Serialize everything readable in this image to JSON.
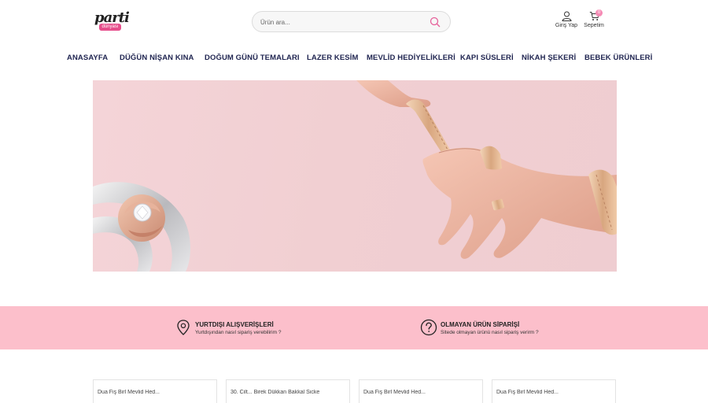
{
  "header": {
    "logo_text": "parti",
    "logo_sub": "dünyası",
    "search_placeholder": "Ürün ara...",
    "login_label": "Giriş Yap",
    "cart_label": "Sepetim",
    "cart_count": "0"
  },
  "nav": {
    "items": [
      {
        "label": "ANASAYFA"
      },
      {
        "label": "DÜĞÜN NİŞAN KINA"
      },
      {
        "label": "DOĞUM GÜNÜ TEMALARI"
      },
      {
        "label": "LAZER KESİM"
      },
      {
        "label": "MEVLİD HEDİYELİKLERİ"
      },
      {
        "label": "KAPI SÜSLERİ"
      },
      {
        "label": "NİKAH ŞEKERİ"
      },
      {
        "label": "BEBEK ÜRÜNLERİ"
      }
    ]
  },
  "info": {
    "items": [
      {
        "title": "YURTDIŞI ALIŞVERİŞLERİ",
        "subtitle": "Yurtdışından nasıl sipariş verebilirim ?",
        "icon": "location-pin-icon"
      },
      {
        "title": "OLMAYAN ÜRÜN SİPARİŞİ",
        "subtitle": "Sitede olmayan ürünü nasıl sipariş verirm ?",
        "icon": "question-icon"
      }
    ]
  },
  "cards": {
    "items": [
      {
        "title": "Dua Fiş Birl Mevlid Hed..."
      },
      {
        "title": "30. Cilt... Birek Dükkan Bakkal Sicke"
      },
      {
        "title": "Dua Fiş Birl Mevlid Hed..."
      },
      {
        "title": "Dua Fiş Birl Mevlid Hed..."
      }
    ]
  },
  "colors": {
    "nav_text": "#1f2450",
    "accent_pink": "#fcbfcb",
    "banner_bg": "#f1cfd2"
  }
}
